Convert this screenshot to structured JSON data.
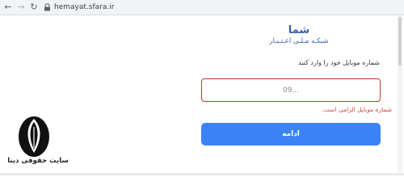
{
  "browser": {
    "url": "hemayat.sfara.ir",
    "icons": {
      "back": "arrow-left-icon",
      "forward": "arrow-right-icon",
      "reload": "reload-icon",
      "lock": "lock-icon"
    }
  },
  "brand": {
    "title": "شما",
    "subtitle": "شبکـه مـلـی اعـتـبـار",
    "color": "#3b5ba8"
  },
  "form": {
    "mobile_label": "شماره موبایل خود را وارد کنید",
    "mobile_placeholder": "09...",
    "mobile_value": "",
    "error_message": "شماره موبایل الزامی است.",
    "continue_label": "ادامه",
    "error_color": "#d0453a",
    "button_color": "#3b82f6"
  },
  "watermark": {
    "text": "سایت حقوقی دینا"
  }
}
